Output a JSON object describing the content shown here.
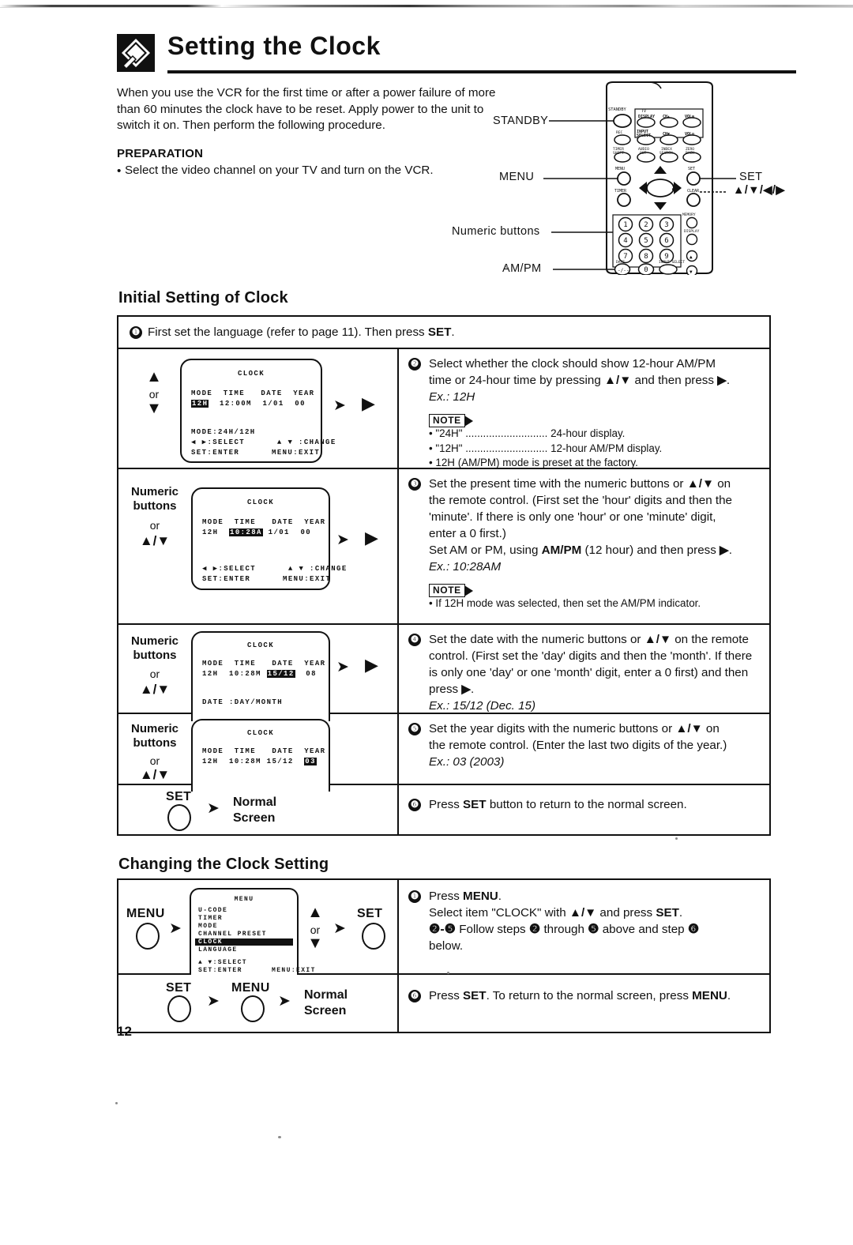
{
  "document": {
    "page_number": "12",
    "header_title": "Setting the Clock",
    "header_icon": "clock-setting-icon"
  },
  "intro": {
    "paragraph": "When you use the VCR for the first time or after a power failure of more than 60 minutes the clock have to be reset. Apply power to the unit to switch it on. Then perform the following procedure.",
    "preparation_title": "PREPARATION",
    "preparation_bullet": "•",
    "preparation_text": "Select the video channel on your TV and turn on the VCR."
  },
  "remote": {
    "labels": {
      "standby": "STANDBY",
      "menu": "MENU",
      "numeric_buttons": "Numeric buttons",
      "am_pm": "AM/PM",
      "set": "SET",
      "cursor": "▲/▼/◀/▶"
    },
    "keypad": [
      "1",
      "2",
      "3",
      "4",
      "5",
      "6",
      "7",
      "8",
      "9",
      "0"
    ],
    "top_labels": [
      "TV",
      "DISPLAY",
      "CH ▲",
      "VOL ⊕",
      "INPUT SELECT",
      "CH ▼",
      "VOL ⊖",
      "TIMER",
      "AUDIO OUT",
      "INDEX SEARCH",
      "ZERO BACK",
      "MENU",
      "SET",
      "TIMER",
      "CLEAR",
      "MEMORY",
      "DISPLAY",
      "REC",
      "INPUT SELECT"
    ]
  },
  "section_initial": {
    "title": "Initial Setting of Clock",
    "step1": {
      "num": "❶",
      "text_before": "First set the language (refer to page 11). Then press ",
      "bold": "SET",
      "text_after": "."
    },
    "step2": {
      "num": "❷",
      "line1": "Select whether the clock should show 12-hour AM/PM",
      "line2_a": "time or 24-hour time by pressing ",
      "line2_arrows": "▲/▼",
      "line2_b": " and then press ",
      "line2_c": "▶",
      "line2_d": ".",
      "example": "Ex.: 12H",
      "note_label": "NOTE",
      "note_items": [
        "• \"24H\" ............................ 24-hour display.",
        "• \"12H\" ............................ 12-hour AM/PM display.",
        "• 12H (AM/PM) mode is preset at the factory."
      ],
      "left_labels": {
        "or": "or",
        "up": "▲",
        "down": "▼"
      },
      "osd": {
        "title": "CLOCK",
        "headers": [
          "MODE",
          "TIME",
          "DATE",
          "YEAR"
        ],
        "values": [
          "12H",
          "12:00M",
          "1/01",
          "00"
        ],
        "highlight_index": 0,
        "footer": [
          "MODE:24H/12H",
          "◀ ▶:SELECT      ▲ ▼ :CHANGE",
          "SET:ENTER      MENU:EXIT"
        ]
      }
    },
    "step3": {
      "num": "❸",
      "line1": "Set the present time with the numeric buttons or ",
      "line1_arrows": "▲/▼",
      "line1_b": " on",
      "line2": "the remote control. (First set the 'hour' digits and then the",
      "line3": "'minute'. If there is only one 'hour' or one 'minute' digit,",
      "line4": "enter a 0 first.)",
      "line5_a": "Set AM or PM, using ",
      "line5_bold": "AM/PM",
      "line5_b": " (12 hour) and then press ",
      "line5_arrow": "▶",
      "line5_c": ".",
      "example": "Ex.: 10:28AM",
      "note_label": "NOTE",
      "note_items": [
        "• If 12H mode was selected, then set the AM/PM indicator."
      ],
      "left_labels": {
        "l1": "Numeric",
        "l2": "buttons",
        "or": "or",
        "arrows": "▲/▼"
      },
      "osd": {
        "title": "CLOCK",
        "headers": [
          "MODE",
          "TIME",
          "DATE",
          "YEAR"
        ],
        "values": [
          "12H",
          "10:28A",
          "1/01",
          "00"
        ],
        "highlight_index": 1,
        "footer": [
          "",
          "◀ ▶:SELECT      ▲ ▼ :CHANGE",
          "SET:ENTER      MENU:EXIT"
        ]
      }
    },
    "step4": {
      "num": "❹",
      "line1": "Set the date with the numeric buttons or ",
      "line1_arrows": "▲/▼",
      "line1_b": " on the remote",
      "line2": "control. (First set the 'day' digits and then the 'month'. If there",
      "line3": "is only one 'day' or one 'month' digit, enter a 0 first) and then",
      "line4_a": "press ",
      "line4_arrow": "▶",
      "line4_b": ".",
      "example": "Ex.: 15/12 (Dec. 15)",
      "left_labels": {
        "l1": "Numeric",
        "l2": "buttons",
        "or": "or",
        "arrows": "▲/▼"
      },
      "osd": {
        "title": "CLOCK",
        "headers": [
          "MODE",
          "TIME",
          "DATE",
          "YEAR"
        ],
        "values": [
          "12H",
          "10:28M",
          "15/12",
          "08"
        ],
        "highlight_index": 2,
        "footer": [
          "DATE :DAY/MONTH"
        ]
      }
    },
    "step5": {
      "num": "❺",
      "line1": "Set the year digits with the numeric buttons or ",
      "line1_arrows": "▲/▼",
      "line1_b": " on",
      "line2": "the remote control. (Enter the last two digits of the year.)",
      "example": "Ex.: 03 (2003)",
      "left_labels": {
        "l1": "Numeric",
        "l2": "buttons",
        "or": "or",
        "arrows": "▲/▼"
      },
      "osd": {
        "title": "CLOCK",
        "headers": [
          "MODE",
          "TIME",
          "DATE",
          "YEAR"
        ],
        "values": [
          "12H",
          "10:28M",
          "15/12",
          "03"
        ],
        "highlight_index": 3,
        "footer": []
      }
    },
    "step6": {
      "num": "❻",
      "text_a": "Press ",
      "bold": "SET",
      "text_b": " button to return to the normal screen.",
      "set_label": "SET",
      "arrow": "➤",
      "normal_l1": "Normal",
      "normal_l2": "Screen"
    }
  },
  "section_changing": {
    "title": "Changing the Clock Setting",
    "step1": {
      "num": "❶",
      "line1_a": "Press ",
      "line1_bold": "MENU",
      "line1_b": ".",
      "line2_a": "Select item \"CLOCK\" with ",
      "line2_arrows": "▲/▼",
      "line2_b": " and press ",
      "line2_bold": "SET",
      "line2_c": ".",
      "line3_a": "❷-❺",
      "line3_b": " Follow steps ",
      "line3_c": "❷",
      "line3_d": " through ",
      "line3_e": "❺",
      "line3_f": " above and step ",
      "line3_g": "❻",
      "line4": "below.",
      "menu_label": "MENU",
      "set_label": "SET",
      "or_label": "or",
      "up": "▲",
      "down": "▼",
      "osd": {
        "title": "MENU",
        "items": [
          "U-CODE",
          "TIMER",
          "MODE",
          "CHANNEL PRESET",
          "CLOCK",
          "LANGUAGE"
        ],
        "highlight_item": "CLOCK",
        "footer": [
          "▲ ▼:SELECT",
          "SET:ENTER      MENU:EXIT"
        ]
      }
    },
    "step6": {
      "num": "❻",
      "text_a": "Press ",
      "bold_a": "SET",
      "text_b": ". To return to the normal screen, press ",
      "bold_b": "MENU",
      "text_c": ".",
      "set_label": "SET",
      "menu_label": "MENU",
      "normal_l1": "Normal",
      "normal_l2": "Screen"
    }
  }
}
